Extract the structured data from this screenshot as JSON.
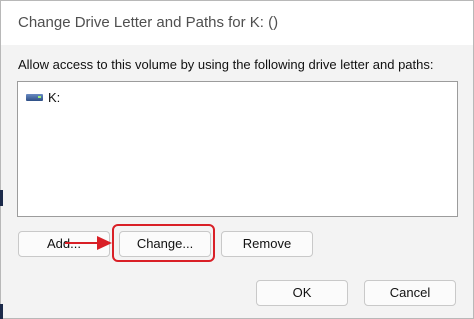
{
  "window": {
    "title": "Change Drive Letter and Paths for K: ()"
  },
  "instructions": "Allow access to this volume by using the following drive letter and paths:",
  "list": {
    "items": [
      {
        "label": "K:",
        "icon": "drive-icon"
      }
    ]
  },
  "buttons": {
    "add": "Add...",
    "change": "Change...",
    "remove": "Remove",
    "ok": "OK",
    "cancel": "Cancel"
  },
  "annotation": {
    "highlight_color": "#d91f26",
    "arrow_icon": "arrow-right-icon"
  }
}
